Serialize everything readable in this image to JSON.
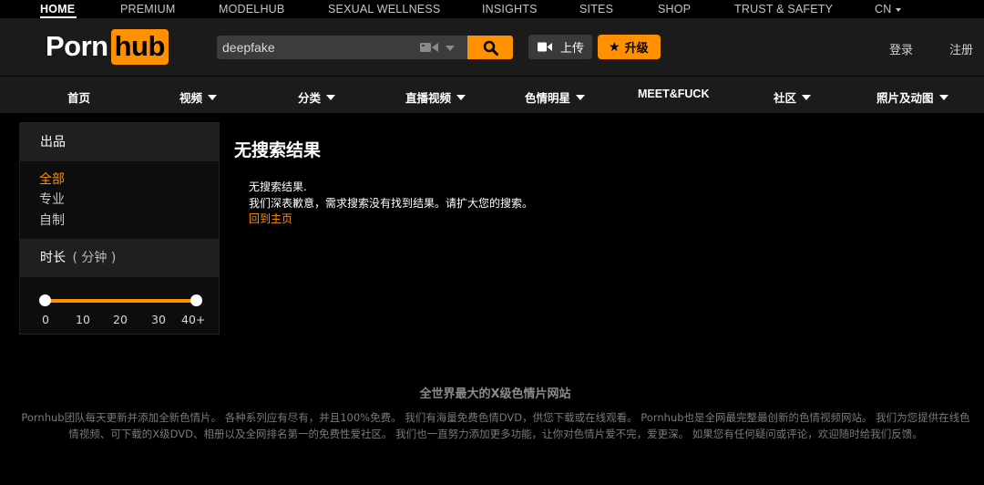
{
  "topbar": {
    "items": [
      "HOME",
      "PREMIUM",
      "MODELHUB",
      "SEXUAL WELLNESS",
      "INSIGHTS",
      "SITES",
      "SHOP",
      "TRUST & SAFETY",
      "CN"
    ]
  },
  "header": {
    "logo_left": "Porn",
    "logo_right": "hub",
    "search_value": "deepfake",
    "upload_label": "上传",
    "upgrade_label": "升级",
    "login_label": "登录",
    "register_label": "注册"
  },
  "nav": {
    "items": [
      "首页",
      "视频",
      "分类",
      "直播视频",
      "色情明星",
      "MEET&FUCK",
      "社区",
      "照片及动图"
    ]
  },
  "sidebar": {
    "production_title": "出品",
    "production_items": [
      "全部",
      "专业",
      "自制"
    ],
    "duration_title": "时长",
    "duration_unit": "( 分钟 )",
    "duration_ticks": [
      "0",
      "10",
      "20",
      "30",
      "40+"
    ],
    "duration_range": [
      0,
      40
    ]
  },
  "main": {
    "title": "无搜索结果",
    "line1": "无搜索结果.",
    "line2": "我们深表歉意，需求搜索没有找到结果。请扩大您的搜索。",
    "back_link": "回到主页"
  },
  "footer": {
    "title": "全世界最大的X级色情片网站",
    "text": "Pornhub团队每天更新并添加全新色情片。 各种系列应有尽有，并且100%免费。 我们有海量免费色情DVD，供您下载或在线观看。 Pornhub也是全网最完整最创新的色情视频网站。 我们为您提供在线色情视频、可下载的X级DVD、相册以及全网排名第一的免费性爱社区。 我们也一直努力添加更多功能，让你对色情片爱不完，爱更深。 如果您有任何疑问或评论，欢迎随时给我们反馈。"
  },
  "colors": {
    "accent": "#ff9000",
    "header_bg": "#1b1b1b",
    "page_bg": "#000000"
  }
}
